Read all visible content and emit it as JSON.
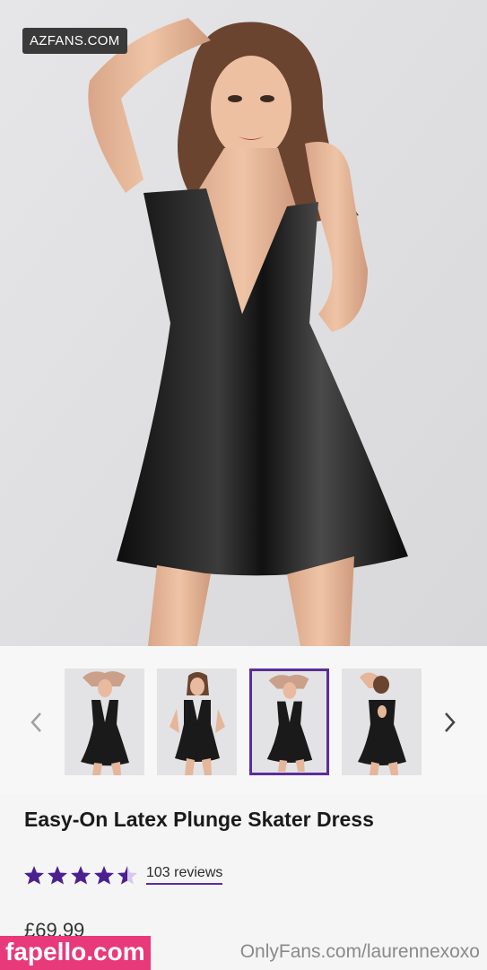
{
  "watermarks": {
    "top": "AZFANS.COM",
    "bottom_left": "fapello.com",
    "bottom_right": "OnlyFans.com/laurennexoxo"
  },
  "gallery": {
    "prev_icon": "chevron-left-icon",
    "next_icon": "chevron-right-icon",
    "thumbnails": [
      {
        "pose": "front-arms-up",
        "selected": false
      },
      {
        "pose": "front-hands-hips",
        "selected": false
      },
      {
        "pose": "front-arms-up",
        "selected": true
      },
      {
        "pose": "back-view",
        "selected": false
      }
    ]
  },
  "product": {
    "title": "Easy-On Latex Plunge Skater Dress",
    "rating": 4.5,
    "reviews_label": "103 reviews",
    "price": "£69.99"
  },
  "colors": {
    "accent": "#5b2d99",
    "star": "#4b2191",
    "fapello": "#e8397a"
  }
}
